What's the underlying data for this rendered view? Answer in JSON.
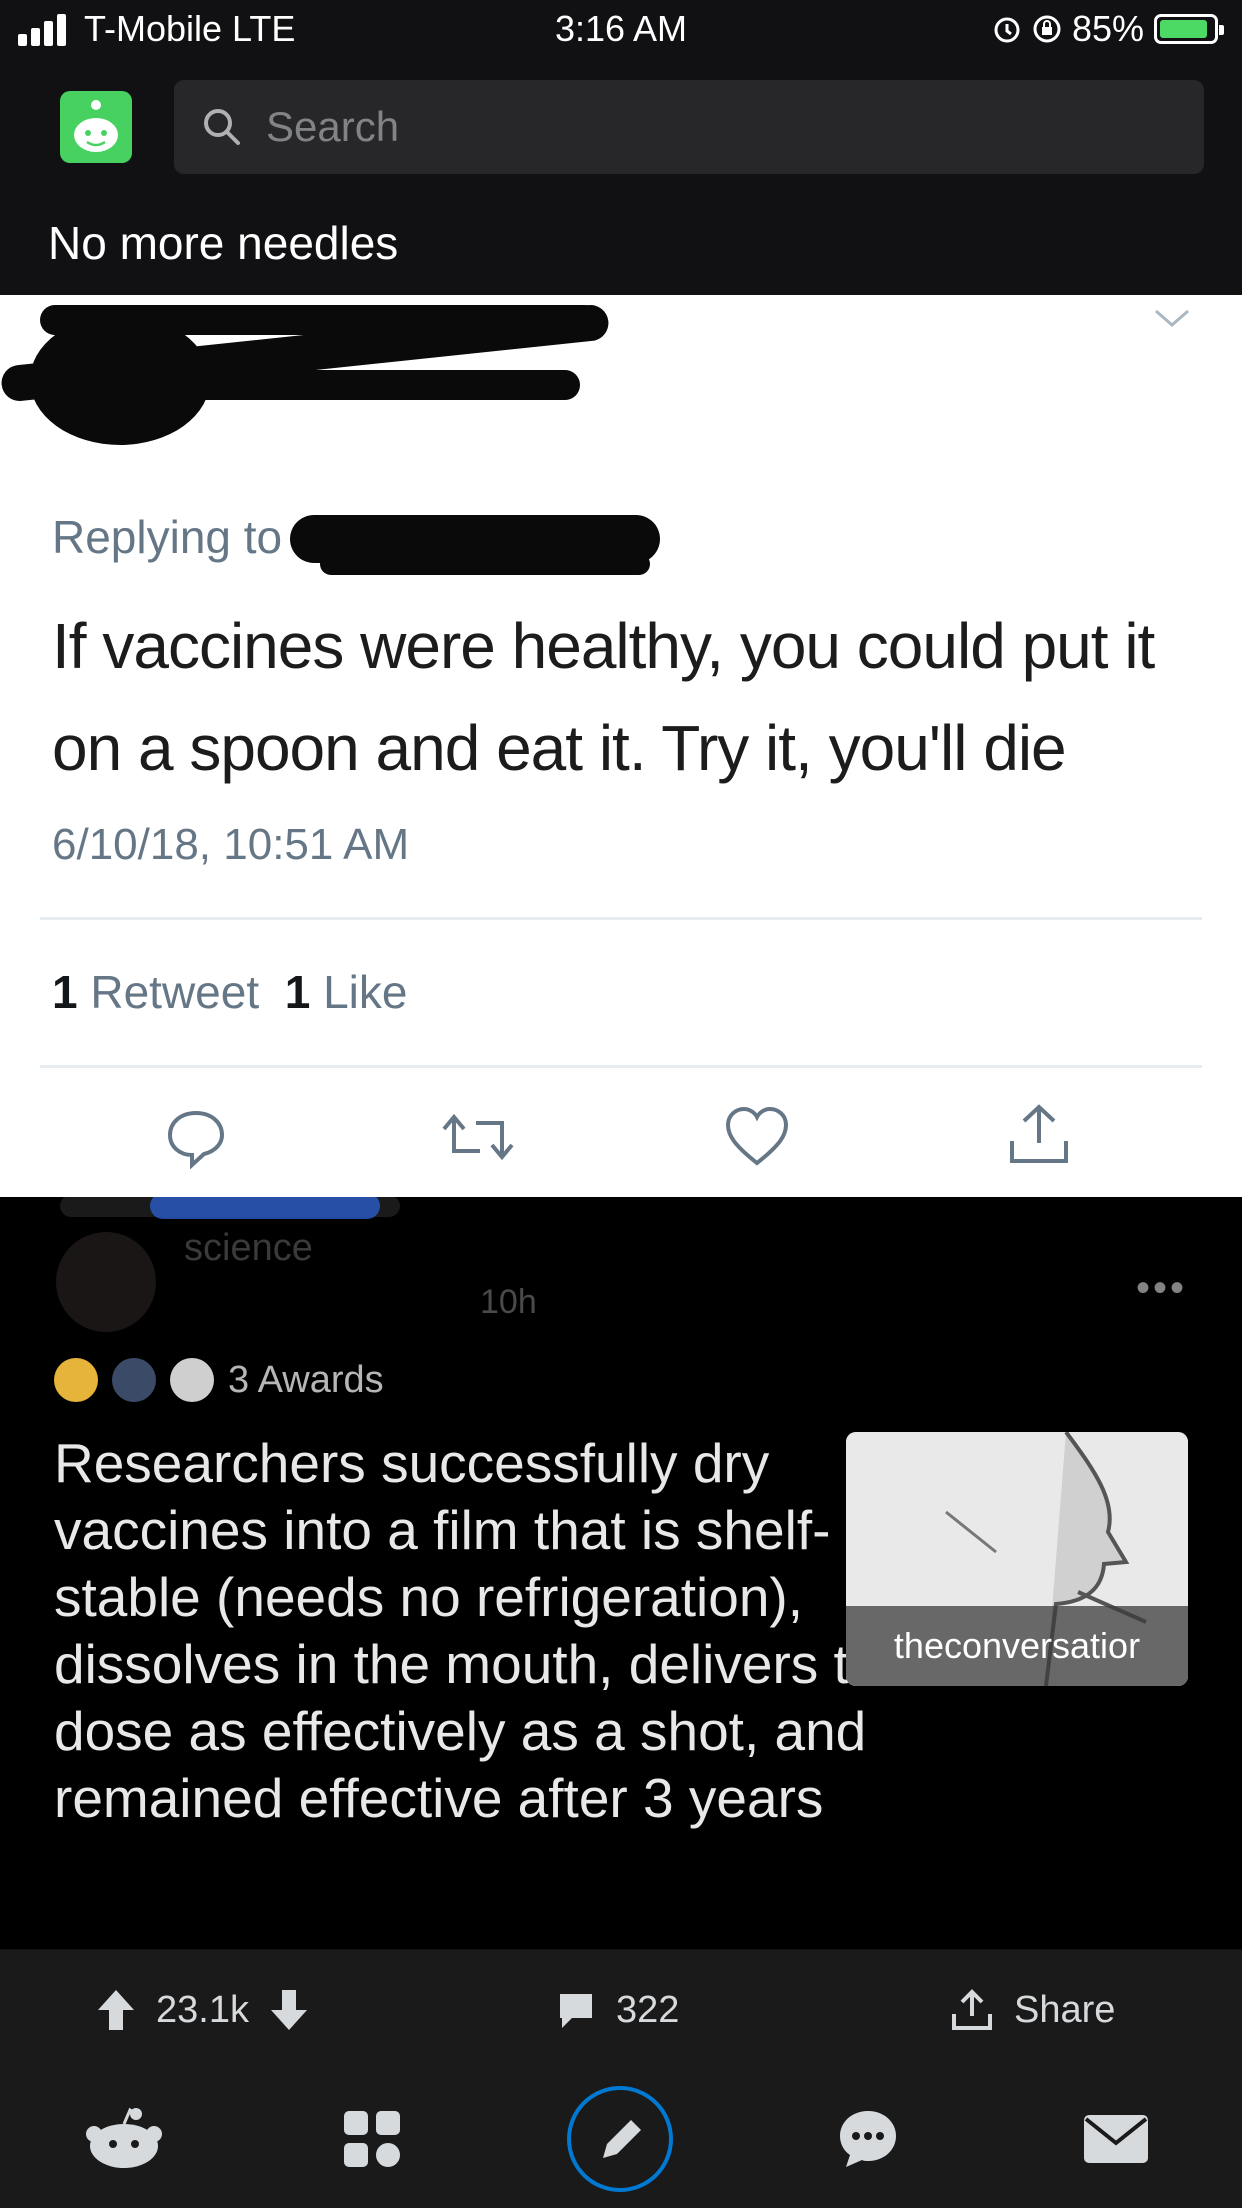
{
  "status_bar": {
    "carrier": "T-Mobile LTE",
    "time": "3:16 AM",
    "battery": "85%"
  },
  "search": {
    "placeholder": "Search"
  },
  "post": {
    "title": "No more needles"
  },
  "tweet": {
    "replying_label": "Replying to",
    "text": "If vaccines were healthy, you could put it on a spoon and eat it. Try it, you'll die",
    "timestamp": "6/10/18, 10:51 AM",
    "retweet_count": "1",
    "retweet_label": "Retweet",
    "like_count": "1",
    "like_label": "Like"
  },
  "crosspost": {
    "subreddit_partial": "science",
    "time_partial": "10h",
    "awards_label": "3 Awards",
    "title": "Researchers successfully dry vaccines into a film that is shelf-stable (needs no refrigeration), dissolves in the mouth, delivers the dose as effectively as a shot, and remained effective after 3 years",
    "thumbnail_domain": "theconversatior"
  },
  "action_bar": {
    "votes": "23.1k",
    "comments": "322",
    "share_label": "Share"
  },
  "tab_bar": [
    "home-icon",
    "communities-icon",
    "create-post-icon",
    "chat-icon",
    "inbox-icon"
  ],
  "colors": {
    "reddit_green": "#46d160",
    "background": "#111113",
    "tweet_gray": "#657786",
    "accent_blue": "#0079d3"
  }
}
